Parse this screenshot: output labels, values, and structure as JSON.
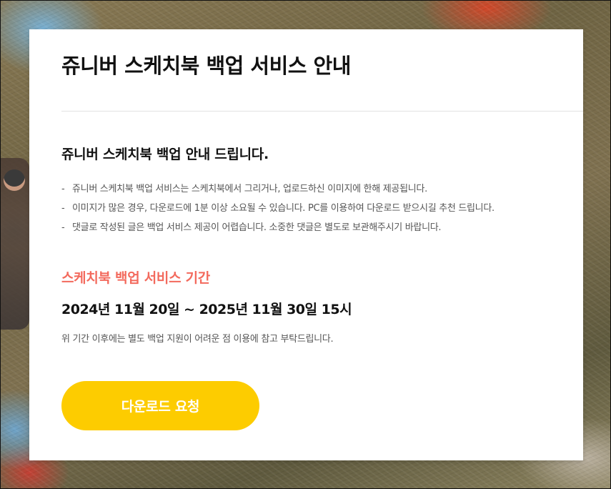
{
  "card": {
    "title": "쥬니버 스케치북 백업 서비스 안내",
    "subtitle": "쥬니버 스케치북 백업 안내 드립니다.",
    "notes": [
      "쥬니버 스케치북 백업 서비스는 스케치북에서 그리거나, 업로드하신 이미지에 한해 제공됩니다.",
      "이미지가 많은 경우, 다운로드에 1분 이상 소요될 수 있습니다. PC를 이용하여 다운로드 받으시길 추천 드립니다.",
      "댓글로 작성된 글은 백업 서비스 제공이 어렵습니다. 소중한 댓글은 별도로 보관해주시기 바랍니다."
    ],
    "note_bullet": "-",
    "period_label": "스케치북 백업 서비스 기간",
    "period_date": "2024년 11월 20일 ~ 2025년 11월 30일 15시",
    "period_note": "위 기간 이후에는 별도 백업 지원이 어려운 점 이용에 참고 부탁드립니다.",
    "download_button": "다운로드 요청"
  },
  "colors": {
    "accent_red": "#f36a5d",
    "button_yellow": "#fdcc00"
  }
}
